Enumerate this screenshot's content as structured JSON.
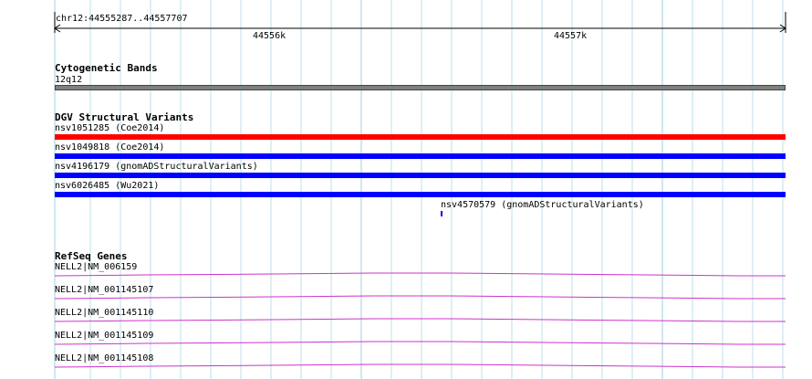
{
  "ruler": {
    "location": "chr12:44555287..44557707",
    "ticks": [
      "44556k",
      "44557k"
    ]
  },
  "cytoband_track": {
    "title": "Cytogenetic Bands",
    "band": "12q12",
    "band_color": "#808080"
  },
  "dgv_track": {
    "title": "DGV Structural Variants",
    "features": [
      {
        "label": "nsv1051285 (Coe2014)",
        "color": "#ff0000"
      },
      {
        "label": "nsv1049818 (Coe2014)",
        "color": "#0000ff"
      },
      {
        "label": "nsv4196179 (gnomADStructuralVariants)",
        "color": "#0000ff"
      },
      {
        "label": "nsv6026485 (Wu2021)",
        "color": "#0000ff"
      },
      {
        "label": "nsv4570579 (gnomADStructuralVariants)",
        "color": "#0000ff"
      }
    ]
  },
  "refseq_track": {
    "title": "RefSeq Genes",
    "gene_color": "#cc33cc",
    "genes": [
      {
        "label": "NELL2|NM_006159"
      },
      {
        "label": "NELL2|NM_001145107"
      },
      {
        "label": "NELL2|NM_001145110"
      },
      {
        "label": "NELL2|NM_001145109"
      },
      {
        "label": "NELL2|NM_001145108"
      }
    ]
  },
  "colors": {
    "grid_line": "#add8e6",
    "ruler_line": "#000000"
  }
}
